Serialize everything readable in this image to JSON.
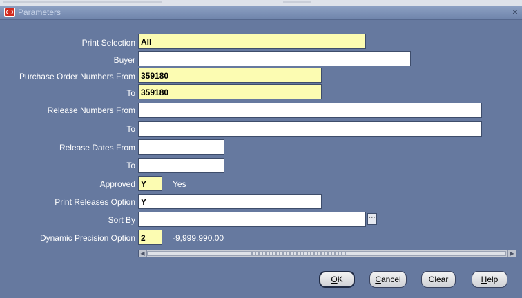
{
  "window": {
    "title": "Parameters",
    "close_glyph": "×"
  },
  "fields": {
    "print_selection": {
      "label": "Print Selection",
      "value": "All"
    },
    "buyer": {
      "label": "Buyer",
      "value": ""
    },
    "po_from": {
      "label": "Purchase Order Numbers From",
      "value": "359180"
    },
    "po_to": {
      "label": "To",
      "value": "359180"
    },
    "release_from": {
      "label": "Release Numbers From",
      "value": ""
    },
    "release_to": {
      "label": "To",
      "value": ""
    },
    "rdate_from": {
      "label": "Release Dates From",
      "value": ""
    },
    "rdate_to": {
      "label": "To",
      "value": ""
    },
    "approved": {
      "label": "Approved",
      "value": "Y",
      "description": "Yes"
    },
    "print_releases": {
      "label": "Print Releases Option",
      "value": "Y"
    },
    "sort_by": {
      "label": "Sort By",
      "value": ""
    },
    "dyn_precision": {
      "label": "Dynamic Precision Option",
      "value": "2",
      "description": "-9,999,990.00"
    }
  },
  "buttons": {
    "ok": {
      "key": "O",
      "rest": "K"
    },
    "cancel": {
      "key": "C",
      "rest": "ancel"
    },
    "clear": {
      "label": "Clear"
    },
    "help": {
      "key": "H",
      "rest": "elp"
    }
  },
  "icons": {
    "lov": "ellipsis-icon",
    "logo": "oracle-logo-icon",
    "close": "close-icon"
  },
  "colors": {
    "background": "#66799f",
    "field_required": "#fcfcb2",
    "field_optional": "#ffffff",
    "label_text": "#ffffff"
  }
}
